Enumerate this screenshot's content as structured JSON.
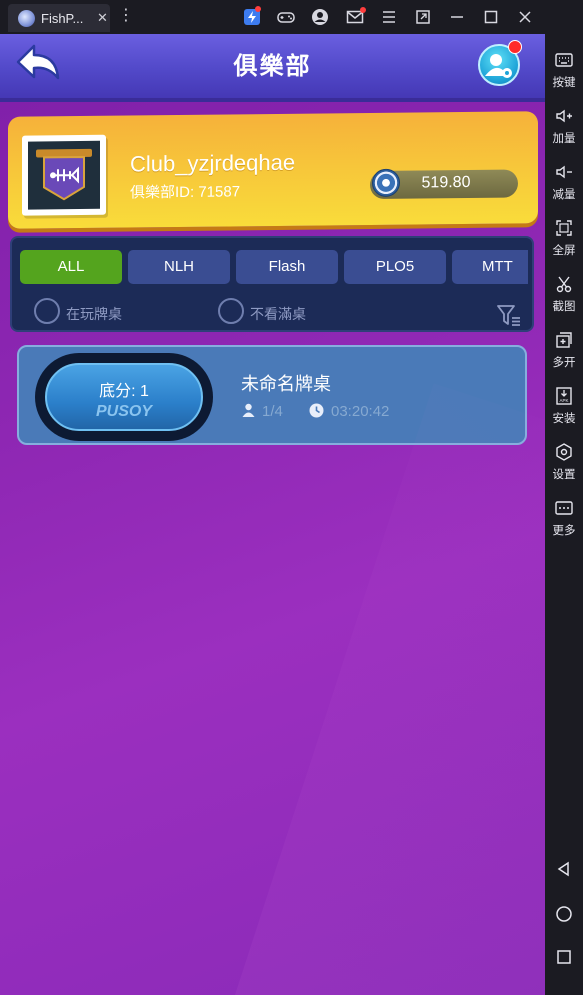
{
  "titlebar": {
    "tab_title": "FishP...",
    "tab_close": "✕",
    "more": "⋮"
  },
  "header": {
    "title": "俱樂部"
  },
  "club": {
    "name": "Club_yzjrdeqhae",
    "id_label": "俱樂部ID: 71587",
    "balance": "519.80"
  },
  "filters": {
    "tabs": [
      "ALL",
      "NLH",
      "Flash",
      "PLO5",
      "MTT"
    ],
    "active_tab": "ALL",
    "option_playing": "在玩牌桌",
    "option_hide_full": "不看滿桌"
  },
  "tables": [
    {
      "base_score": "底分: 1",
      "game_type": "PUSOY",
      "name": "未命名牌桌",
      "seats": "1/4",
      "time_left": "03:20:42"
    }
  ],
  "sidebar": {
    "items": [
      "按键",
      "加量",
      "减量",
      "全屏",
      "截图",
      "多开",
      "安装",
      "设置",
      "更多"
    ]
  },
  "colors": {
    "accent_green": "#54a41e",
    "tab_blue": "#3a4d92",
    "header_blue": "#5249c9",
    "card_gold": "#f7c73a",
    "bg_purple": "#8e27b3",
    "alert_red": "#ff2a2a"
  }
}
